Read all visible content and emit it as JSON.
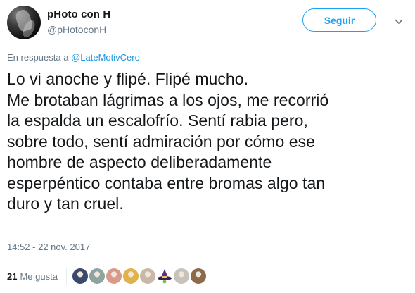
{
  "author": {
    "display_name": "pHoto con H",
    "handle": "@pHotoconH"
  },
  "follow_button": {
    "label": "Seguir"
  },
  "reply_context": {
    "prefix": "En respuesta a",
    "mention": "@LateMotivCero"
  },
  "tweet": {
    "lines": [
      "Lo vi anoche y flipé. Flipé mucho.",
      "Me brotaban lágrimas a los ojos, me recorrió",
      "la espalda un escalofrío. Sentí rabia pero,",
      "sobre todo, sentí admiración por cómo ese",
      "hombre de aspecto deliberadamente",
      "esperpéntico contaba entre bromas algo tan",
      "duro y tan cruel."
    ],
    "timestamp": "14:52 - 22 nov. 2017"
  },
  "stats": {
    "likes_count": "21",
    "likes_label": "Me gusta"
  },
  "likers": [
    {
      "icon": "liker-avatar-1",
      "color": "#3b4a6b"
    },
    {
      "icon": "liker-avatar-2",
      "color": "#8fa3a0"
    },
    {
      "icon": "liker-avatar-3",
      "color": "#d99a8c"
    },
    {
      "icon": "liker-avatar-4",
      "color": "#e0b24a"
    },
    {
      "icon": "liker-avatar-5",
      "color": "#c9b7a8"
    },
    {
      "icon": "liker-avatar-6-witch-hat",
      "color": "#6b3fa0"
    },
    {
      "icon": "liker-avatar-7",
      "color": "#c7c2bb"
    },
    {
      "icon": "liker-avatar-8",
      "color": "#8a6b4a"
    }
  ],
  "colors": {
    "accent": "#1da1f2",
    "link": "#1b95e0",
    "muted": "#657786",
    "text": "#14171a"
  }
}
